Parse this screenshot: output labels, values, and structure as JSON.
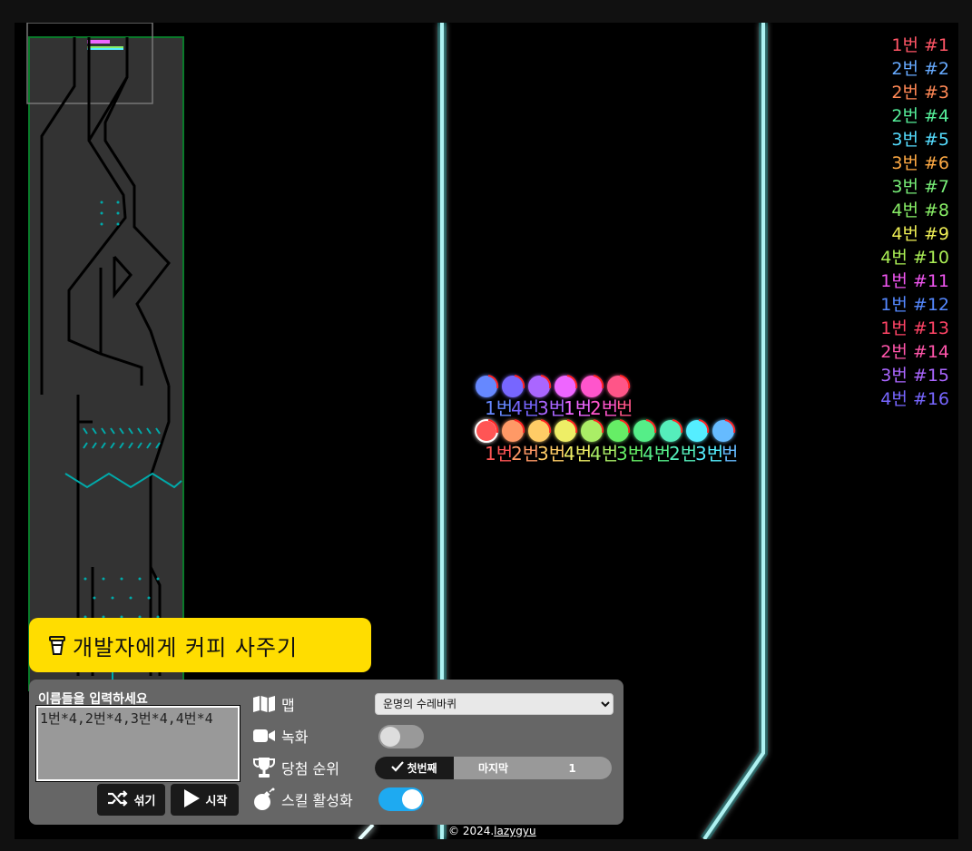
{
  "ranking": [
    {
      "name": "1번",
      "rank": "#1",
      "color": "#ff5566"
    },
    {
      "name": "2번",
      "rank": "#2",
      "color": "#66aaff"
    },
    {
      "name": "2번",
      "rank": "#3",
      "color": "#ff8855"
    },
    {
      "name": "2번",
      "rank": "#4",
      "color": "#55ee99"
    },
    {
      "name": "3번",
      "rank": "#5",
      "color": "#55ddff"
    },
    {
      "name": "3번",
      "rank": "#6",
      "color": "#ffaa44"
    },
    {
      "name": "3번",
      "rank": "#7",
      "color": "#77ee77"
    },
    {
      "name": "4번",
      "rank": "#8",
      "color": "#88ee66"
    },
    {
      "name": "4번",
      "rank": "#9",
      "color": "#eeee55"
    },
    {
      "name": "4번",
      "rank": "#10",
      "color": "#aaee55"
    },
    {
      "name": "1번",
      "rank": "#11",
      "color": "#ee55ee"
    },
    {
      "name": "1번",
      "rank": "#12",
      "color": "#5588ff"
    },
    {
      "name": "1번",
      "rank": "#13",
      "color": "#ff4466"
    },
    {
      "name": "2번",
      "rank": "#14",
      "color": "#ff55aa"
    },
    {
      "name": "3번",
      "rank": "#15",
      "color": "#aa66ff"
    },
    {
      "name": "4번",
      "rank": "#16",
      "color": "#7766ff"
    }
  ],
  "marbles_top": [
    {
      "color": "#6688ff",
      "label": "1번"
    },
    {
      "color": "#7766ff",
      "label": "4번"
    },
    {
      "color": "#aa66ff",
      "label": "3번"
    },
    {
      "color": "#ee66ff",
      "label": "1번"
    },
    {
      "color": "#ff55cc",
      "label": "2번"
    },
    {
      "color": "#ff5588",
      "label": "번"
    }
  ],
  "marbles_bottom": [
    {
      "color": "#ff5555",
      "label": "1번"
    },
    {
      "color": "#ff9966",
      "label": "2번"
    },
    {
      "color": "#ffcc66",
      "label": "3번"
    },
    {
      "color": "#eeee66",
      "label": "4번"
    },
    {
      "color": "#aaee66",
      "label": "4번"
    },
    {
      "color": "#66ee66",
      "label": "3번"
    },
    {
      "color": "#55ee88",
      "label": "4번"
    },
    {
      "color": "#55eebb",
      "label": "2번"
    },
    {
      "color": "#55eeff",
      "label": "3번"
    },
    {
      "color": "#66bbff",
      "label": "번"
    }
  ],
  "coffee_label": "개발자에게 커피 사주기",
  "panel": {
    "names_label": "이름들을 입력하세요",
    "names_value": "1번*4,2번*4,3번*4,4번*4",
    "shuffle_label": "섞기",
    "start_label": "시작",
    "map_label": "맵",
    "map_selected": "운명의 수레바퀴",
    "record_label": "녹화",
    "record_on": false,
    "rank_label": "당첨 순위",
    "rank_first": "첫번째",
    "rank_last": "마지막",
    "rank_value": "1",
    "skill_label": "스킬 활성화",
    "skill_on": true,
    "accent": "#1eaaf1"
  },
  "footer": {
    "copy": "© 2024.",
    "author": "lazygyu"
  }
}
